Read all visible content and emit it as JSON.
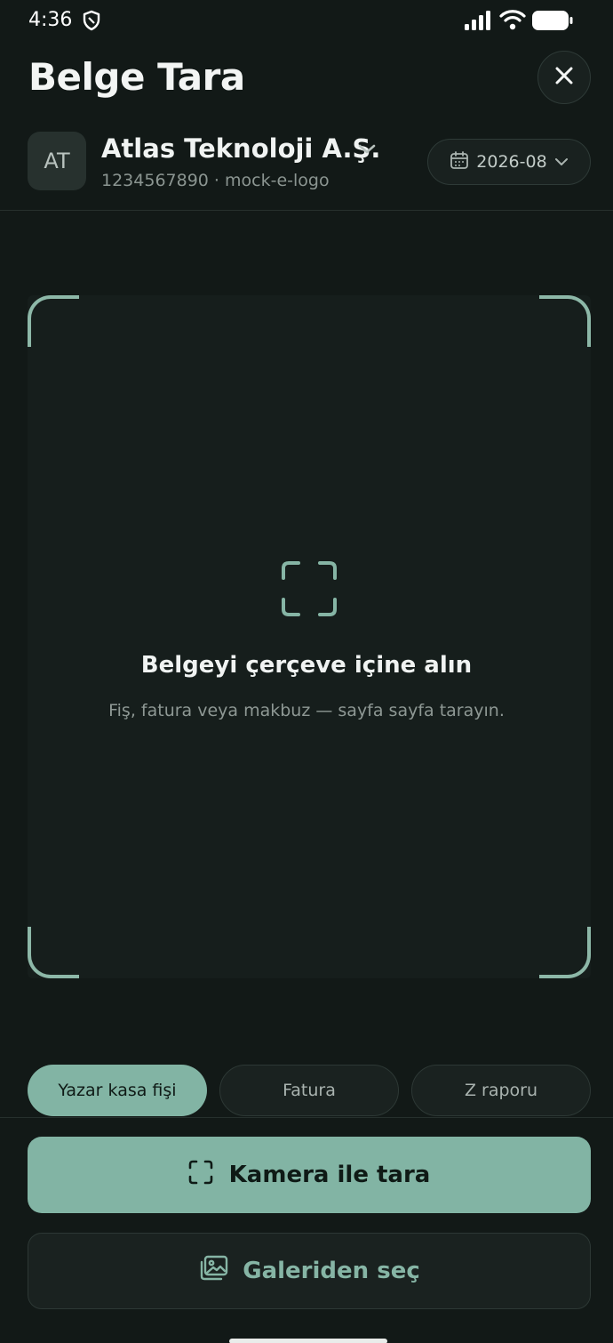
{
  "status_bar": {
    "time": "4:36"
  },
  "header": {
    "title": "Belge Tara"
  },
  "company": {
    "initials": "AT",
    "name": "Atlas Teknoloji A.Ş.",
    "subtitle": "1234567890 · mock-e-logo",
    "period": "2026-08"
  },
  "scan_frame": {
    "title": "Belgeyi çerçeve içine alın",
    "subtitle": "Fiş, fatura veya makbuz — sayfa sayfa tarayın."
  },
  "document_types": [
    {
      "label": "Yazar kasa fişi",
      "selected": true
    },
    {
      "label": "Fatura",
      "selected": false
    },
    {
      "label": "Z raporu",
      "selected": false
    }
  ],
  "actions": {
    "camera_label": "Kamera ile tara",
    "gallery_label": "Galeriden seç"
  },
  "colors": {
    "accent": "#82b4a4",
    "background": "#121917",
    "surface": "#1a2220"
  },
  "icons": {
    "close": "close-icon",
    "chevron": "chevron-down-icon",
    "calendar": "calendar-icon",
    "scan": "scan-frame-icon",
    "gallery": "image-icon"
  }
}
